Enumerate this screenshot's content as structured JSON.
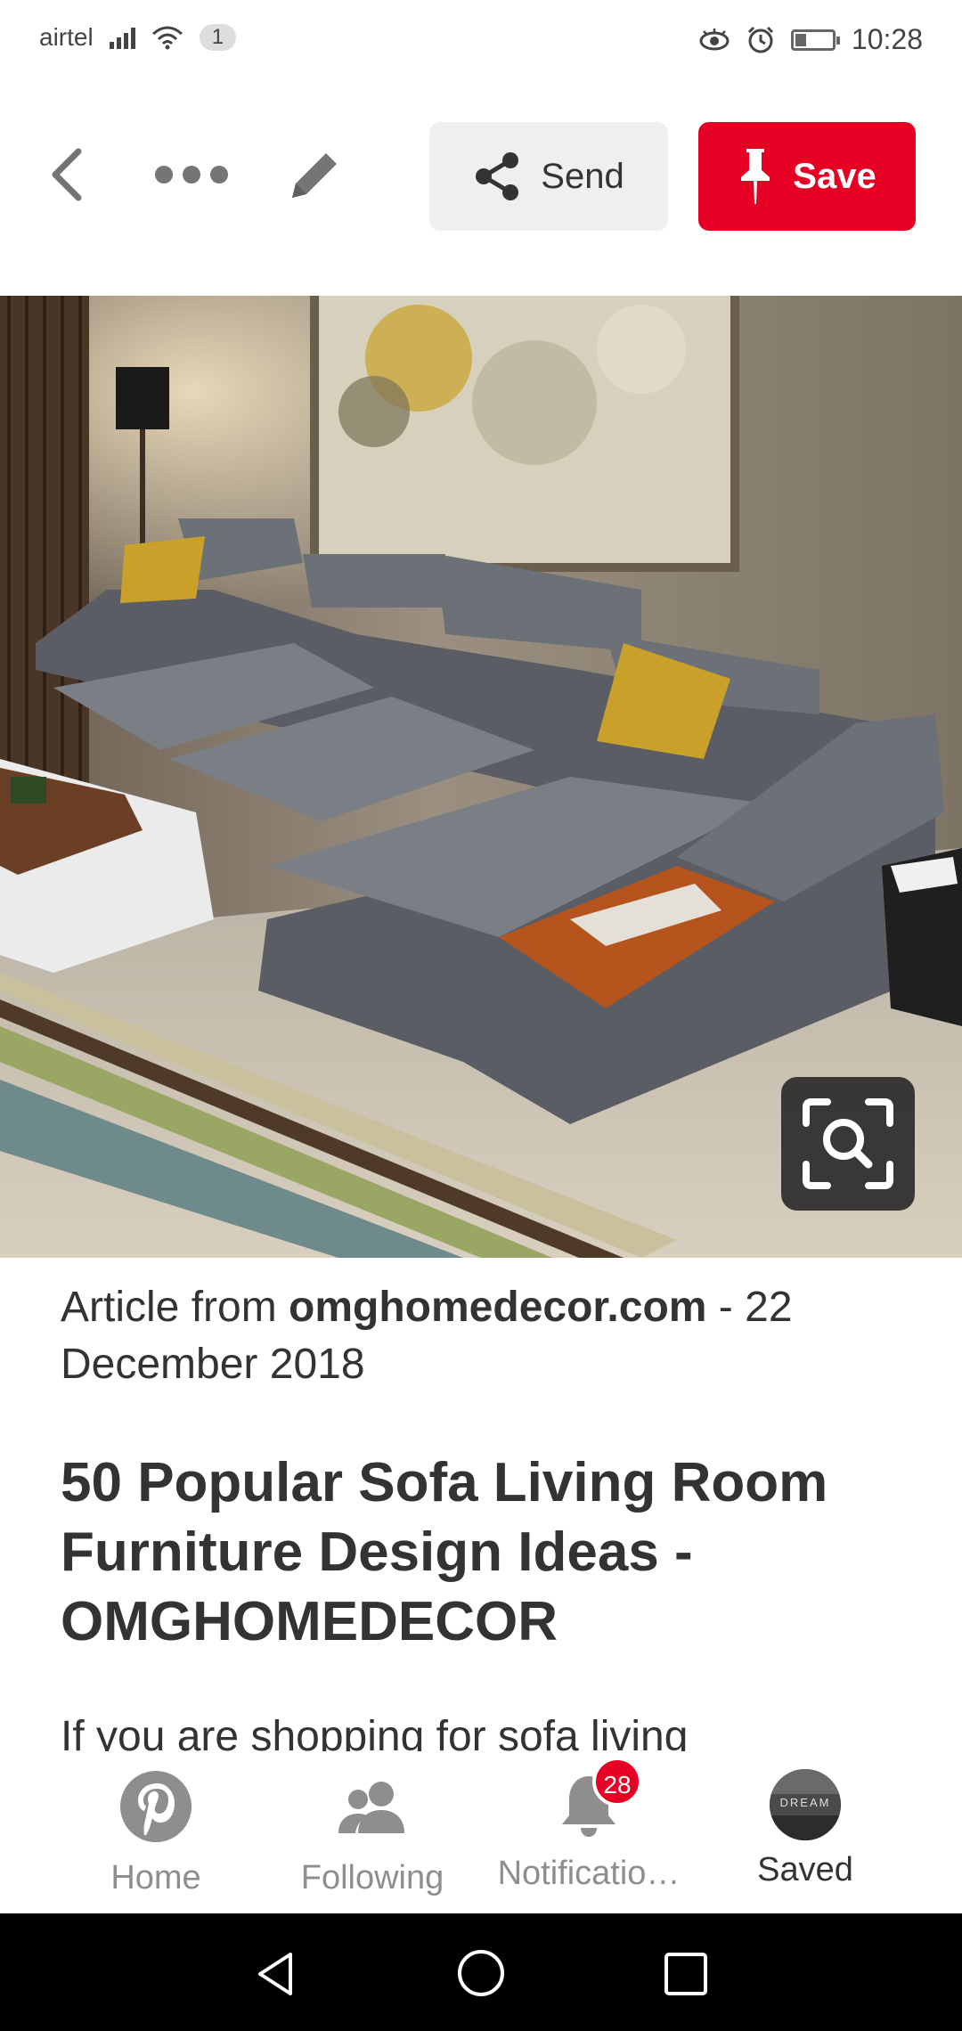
{
  "status_bar": {
    "carrier": "airtel",
    "sim_badge": "1",
    "time": "10:28"
  },
  "toolbar": {
    "send_label": "Send",
    "save_label": "Save"
  },
  "article": {
    "prefix": "Article from ",
    "source": "omghomedecor.com",
    "date": " - 22 December 2018",
    "title": "50 Popular Sofa Living Room Furniture Design Ideas - OMGHOMEDECOR",
    "description": "If you are shopping for sofa living"
  },
  "bottom_nav": {
    "items": [
      {
        "label": "Home",
        "icon": "pinterest-icon"
      },
      {
        "label": "Following",
        "icon": "people-icon"
      },
      {
        "label": "Notificatio…",
        "icon": "bell-icon",
        "badge": "28"
      },
      {
        "label": "Saved",
        "icon": "avatar-icon",
        "avatar_text": "DREAM"
      }
    ]
  },
  "colors": {
    "brand": "#e60023",
    "send_bg": "#efefef",
    "nav_inactive": "#8e8e8e"
  }
}
